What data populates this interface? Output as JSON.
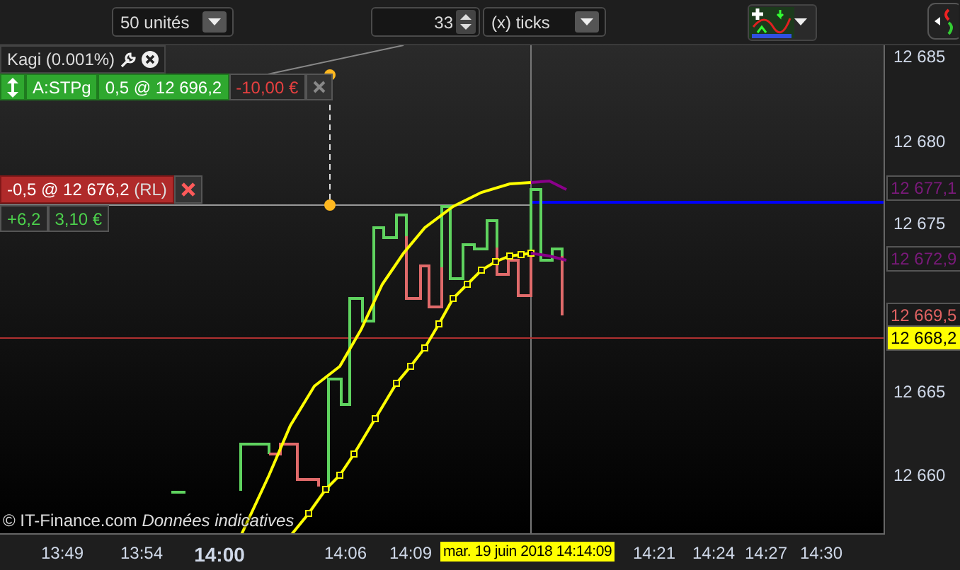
{
  "toolbar": {
    "quantity_select": {
      "value": "50 unités"
    },
    "interval_spinner": {
      "value": "33"
    },
    "unit_select": {
      "value": "(x) ticks"
    }
  },
  "chart": {
    "indicator_tag": {
      "label": "Kagi (0.001%)"
    },
    "stop_order": {
      "name": "A:STPg",
      "position": "0,5 @ 12 696,2",
      "pnl": "-10,00 €"
    },
    "open_position": {
      "label": "-0,5 @ 12 676,2",
      "type": "(RL)",
      "points": "+6,2",
      "pnl": "3,10 €"
    },
    "copyright": "© IT-Finance.com",
    "disclaimer": "Données indicatives",
    "price_axis": [
      {
        "label": "12 685",
        "kind": "tick"
      },
      {
        "label": "12 680",
        "kind": "tick"
      },
      {
        "label": "12 677,1",
        "kind": "marker",
        "color": "#7a1a7a"
      },
      {
        "label": "12 675",
        "kind": "tick"
      },
      {
        "label": "12 672,9",
        "kind": "marker",
        "color": "#7a1a7a"
      },
      {
        "label": "12 669,5",
        "kind": "marker",
        "color": "#e06262"
      },
      {
        "label": "12 668,2",
        "kind": "current"
      },
      {
        "label": "12 665",
        "kind": "tick"
      },
      {
        "label": "12 660",
        "kind": "tick"
      }
    ],
    "time_axis": [
      {
        "label": "13:49",
        "bold": false
      },
      {
        "label": "13:54",
        "bold": false
      },
      {
        "label": "14:00",
        "bold": true
      },
      {
        "label": "14:06",
        "bold": false
      },
      {
        "label": "14:09",
        "bold": false
      },
      {
        "label": "14:21",
        "bold": false
      },
      {
        "label": "14:24",
        "bold": false
      },
      {
        "label": "14:27",
        "bold": false
      },
      {
        "label": "14:30",
        "bold": false
      }
    ],
    "cursor_time": "mar. 19 juin 2018 14:14:09"
  }
}
